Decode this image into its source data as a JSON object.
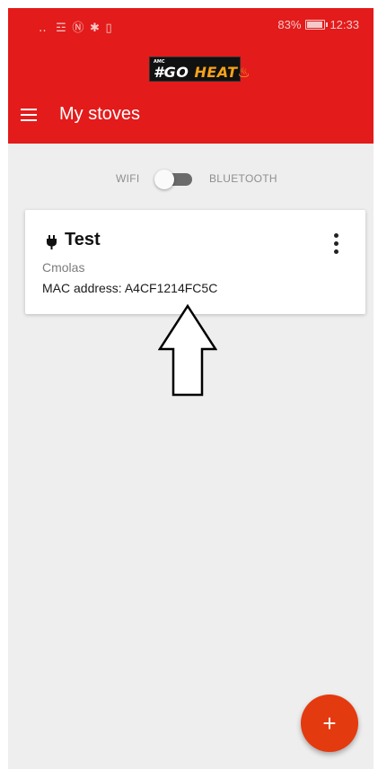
{
  "status_bar": {
    "left_icons": "‥ ☲ Ⓝ ✱ ▯",
    "battery_percent": "83%",
    "time": "12:33"
  },
  "brand": {
    "logo_small": "AMC",
    "logo_prefix": "#GO ",
    "logo_highlight": "HEAT",
    "logo_flame": "♨"
  },
  "app_bar": {
    "title": "My stoves",
    "menu_icon": "hamburger-menu-icon"
  },
  "connection_toggle": {
    "left_label": "WIFI",
    "right_label": "BLUETOOTH",
    "selected": "WIFI"
  },
  "stove_card": {
    "icon": "plug-icon",
    "name": "Test",
    "type": "Cmolas",
    "mac": "MAC address: A4CF1214FC5C",
    "menu_icon": "more-vertical-icon"
  },
  "fab": {
    "label": "+",
    "icon": "add-icon"
  },
  "colors": {
    "app_bar": "#e31b1b",
    "background": "#eeeeee",
    "fab": "#e43a0f",
    "logo_highlight": "#f6a21b"
  }
}
